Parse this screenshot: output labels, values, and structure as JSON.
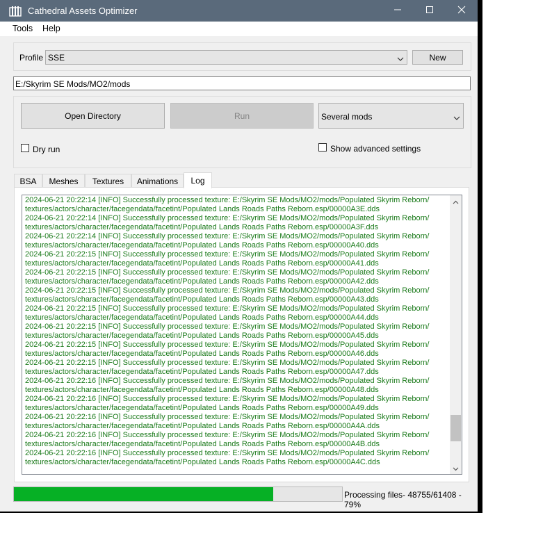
{
  "window": {
    "title": "Cathedral Assets Optimizer"
  },
  "menu": [
    "Tools",
    "Help"
  ],
  "profile": {
    "label": "Profile",
    "value": "SSE",
    "new_label": "New"
  },
  "path": "E:/Skyrim SE Mods/MO2/mods",
  "actions": {
    "open_directory": "Open Directory",
    "run": "Run",
    "mode": "Several mods"
  },
  "options": {
    "dry_run": "Dry run",
    "dry_run_checked": false,
    "show_advanced": "Show advanced settings",
    "show_advanced_checked": false
  },
  "tabs": [
    {
      "label": "BSA",
      "active": false
    },
    {
      "label": "Meshes",
      "active": false
    },
    {
      "label": "Textures",
      "active": false
    },
    {
      "label": "Animations",
      "active": false
    },
    {
      "label": "Log",
      "active": true
    }
  ],
  "log": {
    "color": "#1a7a1a",
    "lines": [
      "2024-06-21 20:22:14 [INFO] Successfully processed texture: E:/Skyrim SE Mods/MO2/mods/Populated Skyrim Reborn/",
      "textures/actors/character/facegendata/facetint/Populated Lands Roads Paths Reborn.esp/00000A3E.dds",
      "2024-06-21 20:22:14 [INFO] Successfully processed texture: E:/Skyrim SE Mods/MO2/mods/Populated Skyrim Reborn/",
      "textures/actors/character/facegendata/facetint/Populated Lands Roads Paths Reborn.esp/00000A3F.dds",
      "2024-06-21 20:22:14 [INFO] Successfully processed texture: E:/Skyrim SE Mods/MO2/mods/Populated Skyrim Reborn/",
      "textures/actors/character/facegendata/facetint/Populated Lands Roads Paths Reborn.esp/00000A40.dds",
      "2024-06-21 20:22:15 [INFO] Successfully processed texture: E:/Skyrim SE Mods/MO2/mods/Populated Skyrim Reborn/",
      "textures/actors/character/facegendata/facetint/Populated Lands Roads Paths Reborn.esp/00000A41.dds",
      "2024-06-21 20:22:15 [INFO] Successfully processed texture: E:/Skyrim SE Mods/MO2/mods/Populated Skyrim Reborn/",
      "textures/actors/character/facegendata/facetint/Populated Lands Roads Paths Reborn.esp/00000A42.dds",
      "2024-06-21 20:22:15 [INFO] Successfully processed texture: E:/Skyrim SE Mods/MO2/mods/Populated Skyrim Reborn/",
      "textures/actors/character/facegendata/facetint/Populated Lands Roads Paths Reborn.esp/00000A43.dds",
      "2024-06-21 20:22:15 [INFO] Successfully processed texture: E:/Skyrim SE Mods/MO2/mods/Populated Skyrim Reborn/",
      "textures/actors/character/facegendata/facetint/Populated Lands Roads Paths Reborn.esp/00000A44.dds",
      "2024-06-21 20:22:15 [INFO] Successfully processed texture: E:/Skyrim SE Mods/MO2/mods/Populated Skyrim Reborn/",
      "textures/actors/character/facegendata/facetint/Populated Lands Roads Paths Reborn.esp/00000A45.dds",
      "2024-06-21 20:22:15 [INFO] Successfully processed texture: E:/Skyrim SE Mods/MO2/mods/Populated Skyrim Reborn/",
      "textures/actors/character/facegendata/facetint/Populated Lands Roads Paths Reborn.esp/00000A46.dds",
      "2024-06-21 20:22:15 [INFO] Successfully processed texture: E:/Skyrim SE Mods/MO2/mods/Populated Skyrim Reborn/",
      "textures/actors/character/facegendata/facetint/Populated Lands Roads Paths Reborn.esp/00000A47.dds",
      "2024-06-21 20:22:16 [INFO] Successfully processed texture: E:/Skyrim SE Mods/MO2/mods/Populated Skyrim Reborn/",
      "textures/actors/character/facegendata/facetint/Populated Lands Roads Paths Reborn.esp/00000A48.dds",
      "2024-06-21 20:22:16 [INFO] Successfully processed texture: E:/Skyrim SE Mods/MO2/mods/Populated Skyrim Reborn/",
      "textures/actors/character/facegendata/facetint/Populated Lands Roads Paths Reborn.esp/00000A49.dds",
      "2024-06-21 20:22:16 [INFO] Successfully processed texture: E:/Skyrim SE Mods/MO2/mods/Populated Skyrim Reborn/",
      "textures/actors/character/facegendata/facetint/Populated Lands Roads Paths Reborn.esp/00000A4A.dds",
      "2024-06-21 20:22:16 [INFO] Successfully processed texture: E:/Skyrim SE Mods/MO2/mods/Populated Skyrim Reborn/",
      "textures/actors/character/facegendata/facetint/Populated Lands Roads Paths Reborn.esp/00000A4B.dds",
      "2024-06-21 20:22:16 [INFO] Successfully processed texture: E:/Skyrim SE Mods/MO2/mods/Populated Skyrim Reborn/",
      "textures/actors/character/facegendata/facetint/Populated Lands Roads Paths Reborn.esp/00000A4C.dds"
    ],
    "scroll_fraction": 0.91
  },
  "progress": {
    "fraction": 0.79,
    "text": "Processing files- 48755/61408 - 79%",
    "color": "#06b025"
  },
  "icons": {
    "app": "cathedral-icon",
    "minimize": "minimize-icon",
    "maximize": "maximize-icon",
    "close": "close-icon"
  }
}
